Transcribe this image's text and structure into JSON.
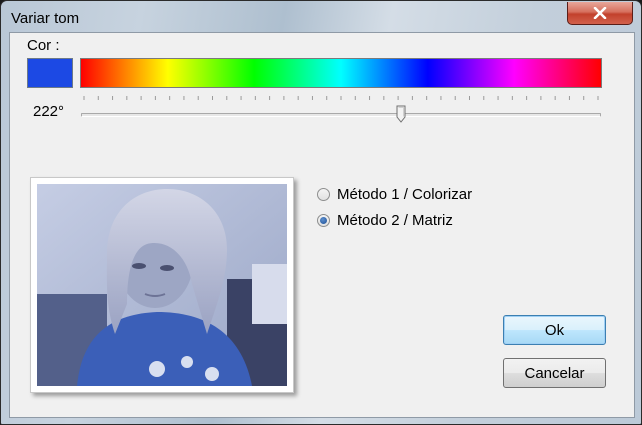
{
  "window": {
    "title": "Variar tom"
  },
  "color": {
    "label": "Cor :",
    "swatch_color": "#1c49e4",
    "hue_degrees": "222°"
  },
  "slider": {
    "min": 0,
    "max": 360,
    "value": 222
  },
  "options": [
    {
      "label": "Método 1 / Colorizar",
      "selected": false
    },
    {
      "label": "Método 2 / Matriz",
      "selected": true
    }
  ],
  "buttons": {
    "ok": "Ok",
    "cancel": "Cancelar"
  },
  "icons": {
    "close": "close-icon"
  }
}
